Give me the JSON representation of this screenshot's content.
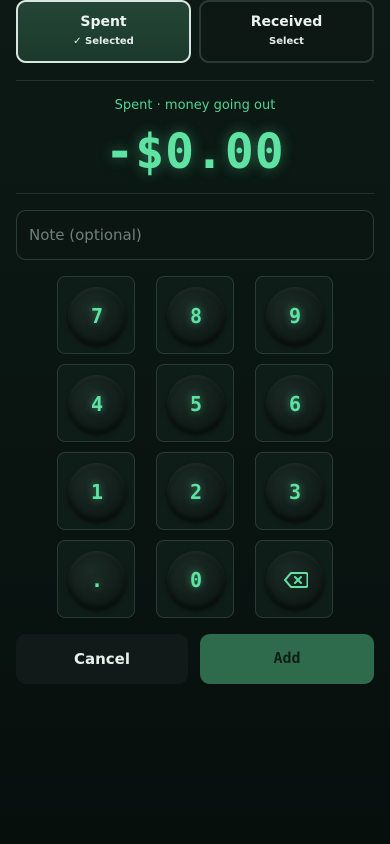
{
  "toggle": {
    "spent_title": "Spent",
    "spent_sub": "✓ Selected",
    "received_title": "Received",
    "received_sub": "Select"
  },
  "amount": {
    "caption": "Spent · money going out",
    "value": "-$0.00"
  },
  "note": {
    "placeholder": "Note (optional)",
    "value": ""
  },
  "keypad": {
    "keys": [
      "7",
      "8",
      "9",
      "4",
      "5",
      "6",
      "1",
      "2",
      "3",
      ".",
      "0"
    ],
    "backspace_icon": "backspace-icon"
  },
  "actions": {
    "cancel_label": "Cancel",
    "add_label": "Add"
  },
  "colors": {
    "accent": "#5fe3a3",
    "add_button": "#2d6b4c",
    "background": "#0a1612"
  }
}
